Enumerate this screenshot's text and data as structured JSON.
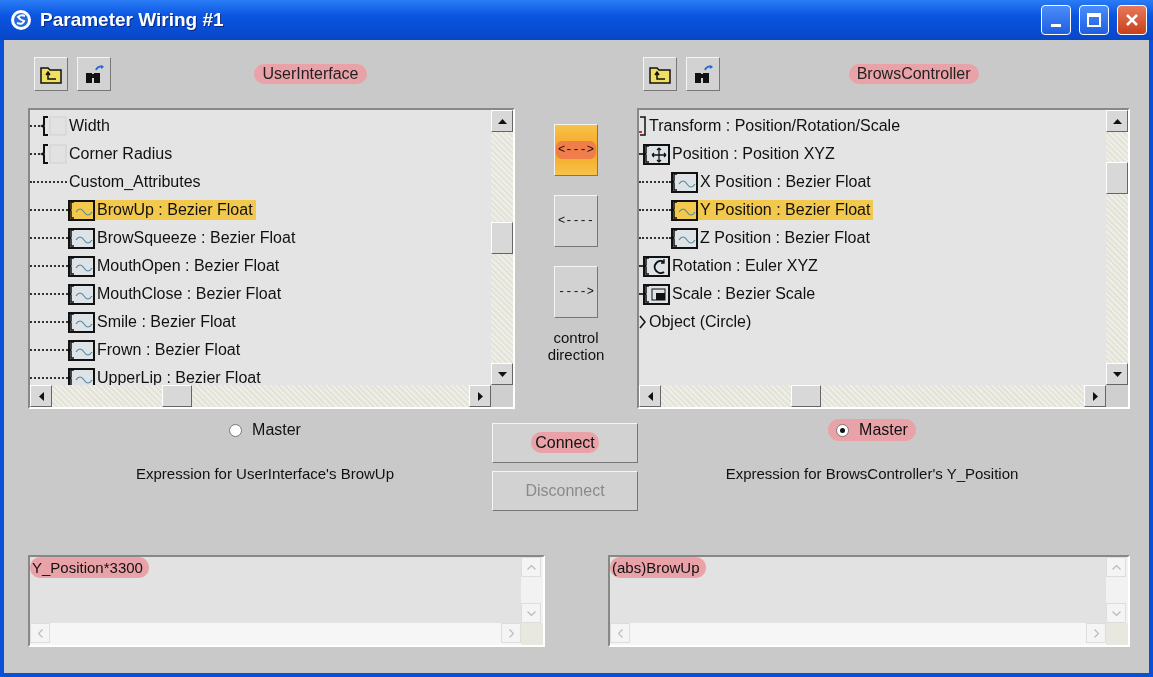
{
  "window": {
    "title": "Parameter Wiring #1"
  },
  "left_panel": {
    "title": "UserInterface",
    "title_highlighted": true,
    "tree": [
      {
        "label": "Width",
        "kind": "param",
        "selected": false
      },
      {
        "label": "Corner Radius",
        "kind": "param",
        "selected": false
      },
      {
        "label": "Custom_Attributes",
        "kind": "group",
        "selected": false,
        "children": [
          {
            "label": "BrowUp : Bezier Float",
            "kind": "float",
            "selected": true
          },
          {
            "label": "BrowSqueeze : Bezier Float",
            "kind": "float",
            "selected": false
          },
          {
            "label": "MouthOpen : Bezier Float",
            "kind": "float",
            "selected": false
          },
          {
            "label": "MouthClose : Bezier Float",
            "kind": "float",
            "selected": false
          },
          {
            "label": "Smile : Bezier Float",
            "kind": "float",
            "selected": false
          },
          {
            "label": "Frown : Bezier Float",
            "kind": "float",
            "selected": false
          },
          {
            "label": "UpperLip : Bezier Float",
            "kind": "float",
            "selected": false
          }
        ]
      }
    ],
    "master": {
      "label": "Master",
      "selected": false,
      "highlighted": false
    },
    "expression_label": "Expression for UserInterface's BrowUp",
    "expression": {
      "value": "Y_Position*3300",
      "highlighted": true
    }
  },
  "direction_buttons": [
    {
      "label": "<--->",
      "selected": true,
      "highlighted": true
    },
    {
      "label": "<----",
      "selected": false,
      "highlighted": false
    },
    {
      "label": "---->",
      "selected": false,
      "highlighted": false
    }
  ],
  "direction_caption": "control direction",
  "connect_buttons": [
    {
      "label": "Connect",
      "disabled": false,
      "highlighted": true
    },
    {
      "label": "Disconnect",
      "disabled": true,
      "highlighted": false
    }
  ],
  "right_panel": {
    "title": "BrowsController",
    "title_highlighted": true,
    "tree": [
      {
        "label": "Transform : Position/Rotation/Scale",
        "kind": "transform",
        "selected": false,
        "children": [
          {
            "label": "Position : Position XYZ",
            "kind": "position",
            "selected": false,
            "children": [
              {
                "label": "X Position : Bezier Float",
                "kind": "float",
                "selected": false
              },
              {
                "label": "Y Position : Bezier Float",
                "kind": "float",
                "selected": true
              },
              {
                "label": "Z Position : Bezier Float",
                "kind": "float",
                "selected": false
              }
            ]
          },
          {
            "label": "Rotation : Euler XYZ",
            "kind": "rotation",
            "selected": false
          },
          {
            "label": "Scale : Bezier Scale",
            "kind": "scale",
            "selected": false
          }
        ]
      },
      {
        "label": "Object (Circle)",
        "kind": "object",
        "selected": false
      }
    ],
    "master": {
      "label": "Master",
      "selected": true,
      "highlighted": true
    },
    "expression_label": "Expression for BrowsController's Y_Position",
    "expression": {
      "value": "(abs)BrowUp",
      "highlighted": true
    }
  }
}
